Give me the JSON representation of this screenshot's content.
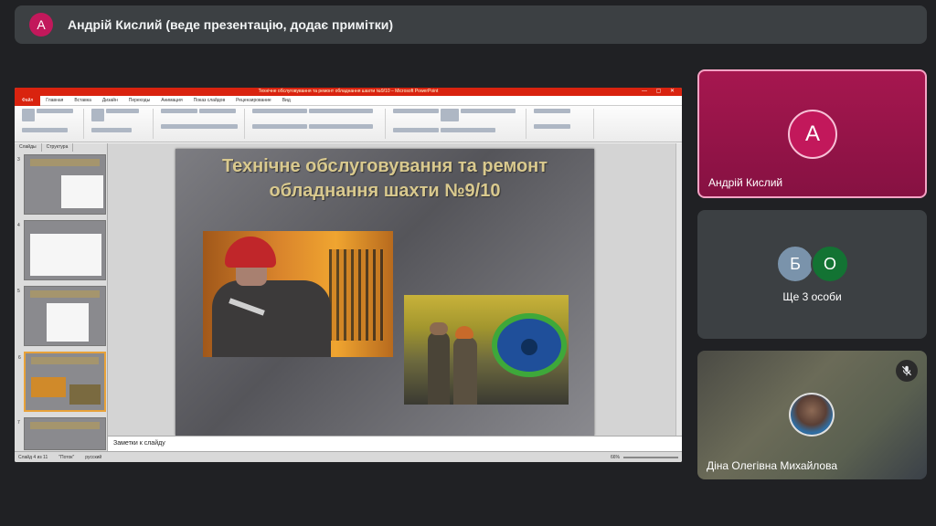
{
  "presenter": {
    "avatar_letter": "А",
    "text": "Андрій Кислий (веде презентацію, додає примітки)"
  },
  "powerpoint": {
    "title_bar": "Технічне обслуговування та ремонт обладнання шахти №9/10 – Microsoft PowerPoint",
    "tabs": [
      "Файл",
      "Главная",
      "Вставка",
      "Дизайн",
      "Переходы",
      "Анимация",
      "Показ слайдов",
      "Рецензирование",
      "Вид"
    ],
    "pane_tabs": [
      "Слайды",
      "Структура"
    ],
    "slide_title": "Технічне обслуговування та ремонт обладнання шахти №9/10",
    "notes_placeholder": "Заметки к слайду",
    "status": {
      "slide": "Слайд 4 из 11",
      "theme": "\"Поток\"",
      "language": "русский",
      "zoom": "66%"
    },
    "thumbnails": [
      {
        "number": "3"
      },
      {
        "number": "4"
      },
      {
        "number": "5"
      },
      {
        "number": "6"
      },
      {
        "number": "7"
      }
    ]
  },
  "participants": [
    {
      "name": "Андрій Кислий",
      "avatar_letter": "А"
    },
    {
      "name": "Ще 3 особи",
      "avatars": [
        "Б",
        "О"
      ]
    },
    {
      "name": "Діна Олегівна Михайлова",
      "muted": true
    }
  ],
  "colors": {
    "presenter_tile": "#a6174f",
    "ppt_accent": "#d9230f",
    "avatar_o": "#137333"
  }
}
